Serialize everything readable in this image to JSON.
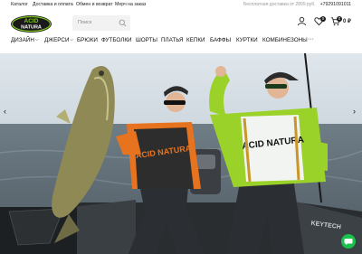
{
  "topbar": {
    "links": [
      "Каталог",
      "Доставка и оплата",
      "Обмен и возврат",
      "Мерч на заказ"
    ],
    "delivery_note": "Бесплатная доставка от 2899 руб.",
    "phone": "+79291091011"
  },
  "brand": {
    "logo_text_1": "ACID",
    "logo_text_2": "NATURA",
    "accent": "#7ec41e"
  },
  "search": {
    "placeholder": "Поиск"
  },
  "header": {
    "favorites_count": "0",
    "cart_count": "0",
    "cart_total": "0 ₽"
  },
  "nav": {
    "items": [
      "ДИЗАЙН",
      "ДЖЕРСИ",
      "БРЮКИ",
      "ФУТБОЛКИ",
      "ШОРТЫ",
      "ПЛАТЬЯ",
      "КЕПКИ",
      "БАФФЫ",
      "КУРТКИ",
      "КОМБИНЕЗОНЫ"
    ],
    "more": "···"
  },
  "hero": {
    "jersey_text_left": "ACID NATURA",
    "jersey_text_right": "ACID NATURA",
    "boat_brand": "KEYTECH"
  },
  "colors": {
    "chat_green": "#19c24a",
    "jersey_orange": "#e8731f",
    "jersey_lime": "#9bd22a"
  }
}
